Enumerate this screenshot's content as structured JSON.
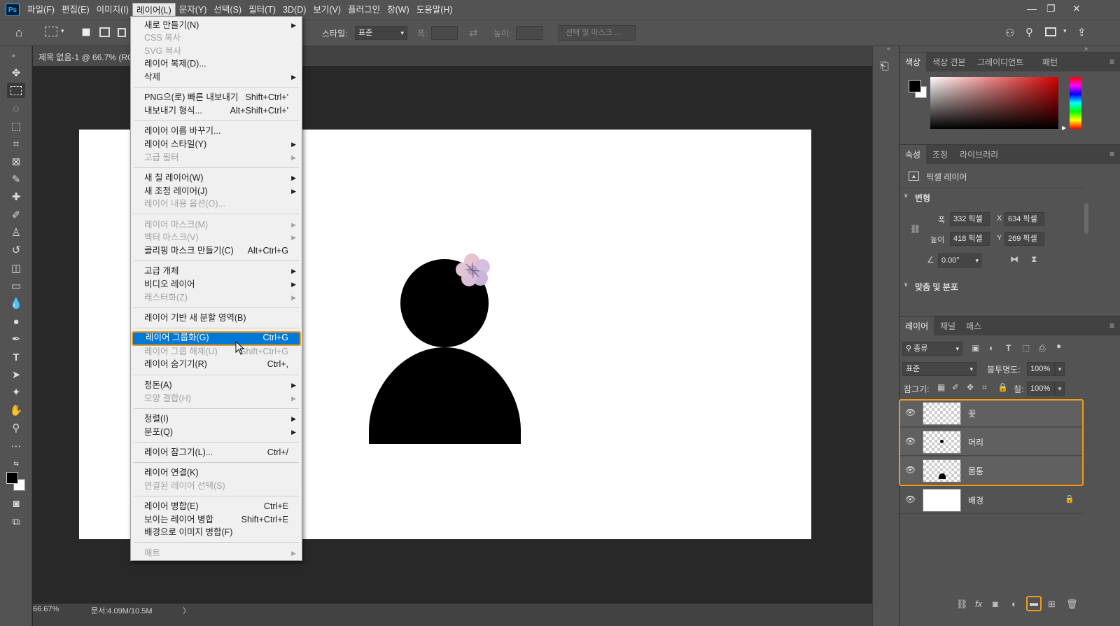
{
  "app_logo": "Ps",
  "menubar": [
    "파일(F)",
    "편집(E)",
    "이미지(I)",
    "레이어(L)",
    "문자(Y)",
    "선택(S)",
    "필터(T)",
    "3D(D)",
    "보기(V)",
    "플러그인",
    "창(W)",
    "도움말(H)"
  ],
  "window_controls": [
    "—",
    "❐",
    "✕"
  ],
  "options_bar": {
    "style_label": "스타일:",
    "style_value": "표준",
    "width_label": "폭:",
    "height_label": "높이:",
    "select_mask": "선택 및 마스크 ..."
  },
  "document": {
    "tab_title": "제목 없음-1 @ 66.7% (RGB/8)",
    "zoom": "66.67%",
    "doc_info": "문서:4.09M/10.5M"
  },
  "layer_menu": {
    "items": [
      {
        "label": "새로 만들기(N)",
        "shortcut": "",
        "submenu": true,
        "disabled": false
      },
      {
        "label": "CSS 복사",
        "shortcut": "",
        "submenu": false,
        "disabled": true
      },
      {
        "label": "SVG 복사",
        "shortcut": "",
        "submenu": false,
        "disabled": true
      },
      {
        "label": "레이어 복제(D)...",
        "shortcut": "",
        "submenu": false,
        "disabled": false
      },
      {
        "label": "삭제",
        "shortcut": "",
        "submenu": true,
        "disabled": false
      },
      {
        "label": "PNG으(로) 빠른 내보내기",
        "shortcut": "Shift+Ctrl+'",
        "submenu": false,
        "disabled": false
      },
      {
        "label": "내보내기 형식...",
        "shortcut": "Alt+Shift+Ctrl+'",
        "submenu": false,
        "disabled": false
      },
      {
        "label": "레이어 이름 바꾸기...",
        "shortcut": "",
        "submenu": false,
        "disabled": false
      },
      {
        "label": "레이어 스타일(Y)",
        "shortcut": "",
        "submenu": true,
        "disabled": false
      },
      {
        "label": "고급 필터",
        "shortcut": "",
        "submenu": true,
        "disabled": true
      },
      {
        "label": "새 칠 레이어(W)",
        "shortcut": "",
        "submenu": true,
        "disabled": false
      },
      {
        "label": "새 조정 레이어(J)",
        "shortcut": "",
        "submenu": true,
        "disabled": false
      },
      {
        "label": "레이어 내용 옵션(O)...",
        "shortcut": "",
        "submenu": false,
        "disabled": true
      },
      {
        "label": "레이어 마스크(M)",
        "shortcut": "",
        "submenu": true,
        "disabled": true
      },
      {
        "label": "벡터 마스크(V)",
        "shortcut": "",
        "submenu": true,
        "disabled": true
      },
      {
        "label": "클리핑 마스크 만들기(C)",
        "shortcut": "Alt+Ctrl+G",
        "submenu": false,
        "disabled": false
      },
      {
        "label": "고급 개체",
        "shortcut": "",
        "submenu": true,
        "disabled": false
      },
      {
        "label": "비디오 레이어",
        "shortcut": "",
        "submenu": true,
        "disabled": false
      },
      {
        "label": "래스터화(Z)",
        "shortcut": "",
        "submenu": true,
        "disabled": true
      },
      {
        "label": "레이어 기반 새 분할 영역(B)",
        "shortcut": "",
        "submenu": false,
        "disabled": false
      },
      {
        "label": "레이어 그룹화(G)",
        "shortcut": "Ctrl+G",
        "submenu": false,
        "disabled": false,
        "highlighted": true
      },
      {
        "label": "레이어 그룹 해제(U)",
        "shortcut": "Shift+Ctrl+G",
        "submenu": false,
        "disabled": true
      },
      {
        "label": "레이어 숨기기(R)",
        "shortcut": "Ctrl+,",
        "submenu": false,
        "disabled": false
      },
      {
        "label": "정돈(A)",
        "shortcut": "",
        "submenu": true,
        "disabled": false
      },
      {
        "label": "모양 결합(H)",
        "shortcut": "",
        "submenu": true,
        "disabled": true
      },
      {
        "label": "정렬(I)",
        "shortcut": "",
        "submenu": true,
        "disabled": false
      },
      {
        "label": "분포(Q)",
        "shortcut": "",
        "submenu": true,
        "disabled": false
      },
      {
        "label": "레이어 잠그기(L)...",
        "shortcut": "Ctrl+/",
        "submenu": false,
        "disabled": false
      },
      {
        "label": "레이어 연결(K)",
        "shortcut": "",
        "submenu": false,
        "disabled": false
      },
      {
        "label": "연결된 레이어 선택(S)",
        "shortcut": "",
        "submenu": false,
        "disabled": true
      },
      {
        "label": "레이어 병합(E)",
        "shortcut": "Ctrl+E",
        "submenu": false,
        "disabled": false
      },
      {
        "label": "보이는 레이어 병합",
        "shortcut": "Shift+Ctrl+E",
        "submenu": false,
        "disabled": false
      },
      {
        "label": "배경으로 이미지 병합(F)",
        "shortcut": "",
        "submenu": false,
        "disabled": false
      },
      {
        "label": "매트",
        "shortcut": "",
        "submenu": true,
        "disabled": true
      }
    ]
  },
  "color_panel": {
    "tabs": [
      "색상",
      "색상 견본",
      "그레이디언트",
      "패턴"
    ]
  },
  "properties_panel": {
    "tabs": [
      "속성",
      "조정",
      "라이브러리"
    ],
    "kind": "픽셀 레이어",
    "section_transform": "변형",
    "w_label": "폭",
    "w_value": "332 픽셀",
    "x_label": "X",
    "x_value": "634 픽셀",
    "h_label": "높이",
    "h_value": "418 픽셀",
    "y_label": "Y",
    "y_value": "269 픽셀",
    "angle_value": "0.00°",
    "section_align": "맞춤 및 분포"
  },
  "layers_panel": {
    "tabs": [
      "레이어",
      "채널",
      "패스"
    ],
    "filter_label": "종류",
    "blend_mode": "표준",
    "opacity_label": "불투명도:",
    "opacity_value": "100%",
    "lock_label": "잠그기:",
    "fill_label": "칠:",
    "fill_value": "100%",
    "layers": [
      {
        "name": "꽃",
        "selected": true
      },
      {
        "name": "머리",
        "selected": true
      },
      {
        "name": "몸통",
        "selected": true
      },
      {
        "name": "배경",
        "selected": false,
        "locked": true
      }
    ]
  },
  "colors": {
    "menu_highlight": "#0078d7",
    "annotation_outline": "#f29a1e",
    "panel_bg": "#535353",
    "canvas_bg": "#282828"
  }
}
